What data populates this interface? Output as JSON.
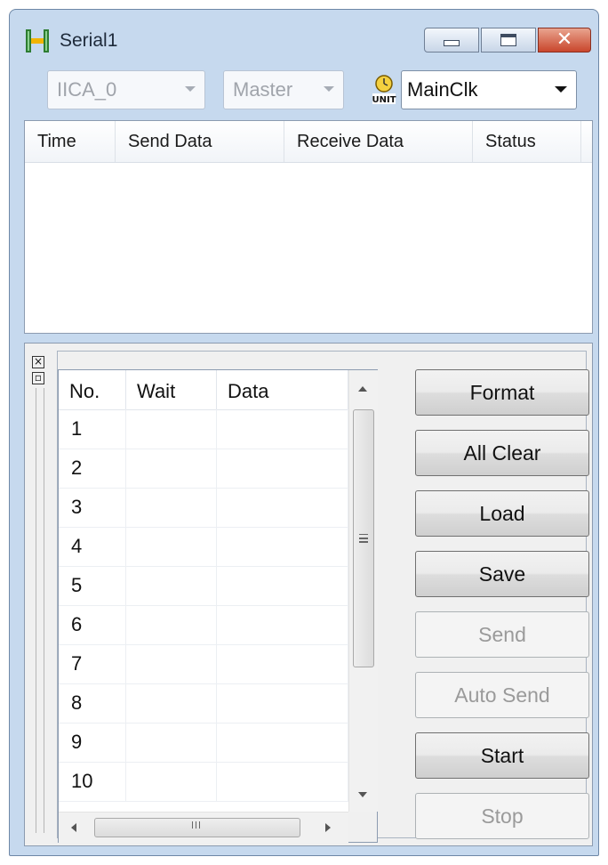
{
  "window": {
    "title": "Serial1",
    "icon": "serial-app-icon",
    "controls": [
      "minimize-icon",
      "maximize-icon",
      "close-icon"
    ]
  },
  "toolbar": {
    "channel": "IICA_0",
    "mode": "Master",
    "clock_icon": "unit-clock-icon",
    "clock": "MainClk"
  },
  "log": {
    "columns": [
      "Time",
      "Send Data",
      "Receive Data",
      "Status"
    ]
  },
  "grid": {
    "columns": [
      "No.",
      "Wait",
      "Data"
    ],
    "rows": [
      {
        "no": "1",
        "wait": "",
        "data": ""
      },
      {
        "no": "2",
        "wait": "",
        "data": ""
      },
      {
        "no": "3",
        "wait": "",
        "data": ""
      },
      {
        "no": "4",
        "wait": "",
        "data": ""
      },
      {
        "no": "5",
        "wait": "",
        "data": ""
      },
      {
        "no": "6",
        "wait": "",
        "data": ""
      },
      {
        "no": "7",
        "wait": "",
        "data": ""
      },
      {
        "no": "8",
        "wait": "",
        "data": ""
      },
      {
        "no": "9",
        "wait": "",
        "data": ""
      },
      {
        "no": "10",
        "wait": "",
        "data": ""
      }
    ]
  },
  "buttons": {
    "format": "Format",
    "all_clear": "All Clear",
    "load": "Load",
    "save": "Save",
    "send": "Send",
    "auto_send": "Auto Send",
    "start": "Start",
    "stop": "Stop"
  },
  "colors": {
    "frame": "#c6d9ee",
    "close_button": "#c9462c",
    "disabled_text": "#9a9a9a"
  }
}
